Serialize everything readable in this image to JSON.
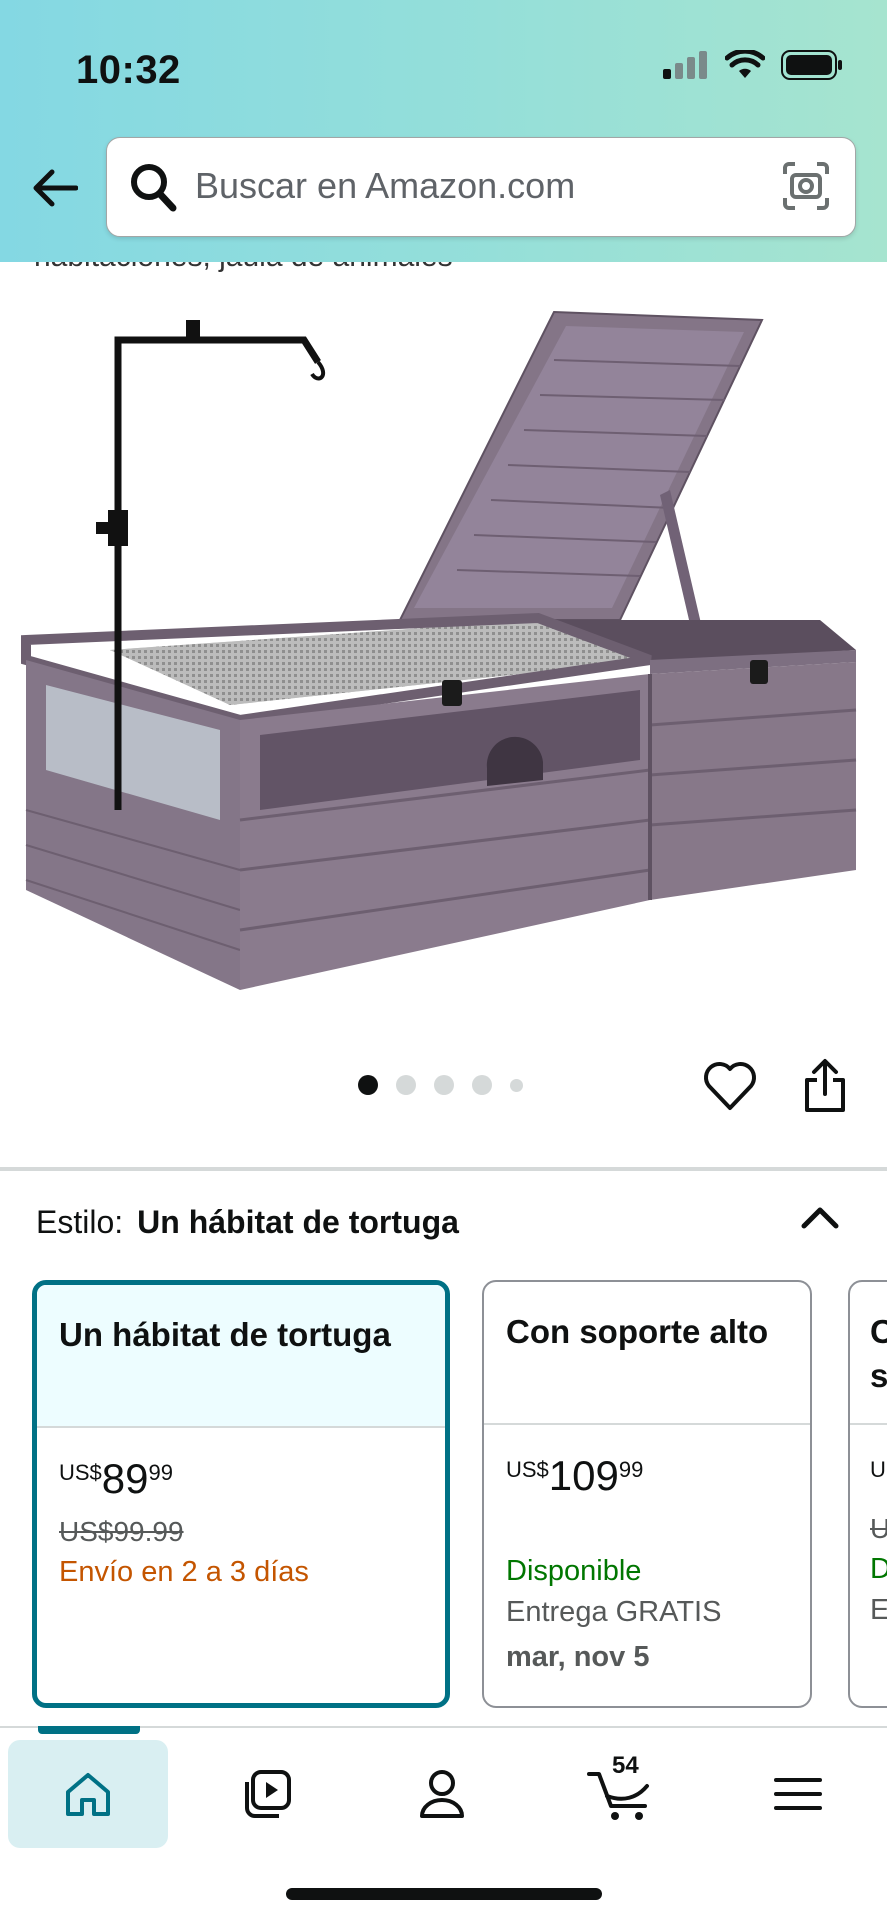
{
  "status_bar": {
    "time": "10:32"
  },
  "search": {
    "placeholder": "Buscar en Amazon.com"
  },
  "product": {
    "title_peek": "habitaciones, jaula de animales"
  },
  "carousel": {
    "total_dots": 5,
    "active_index": 0
  },
  "style_selector": {
    "label": "Estilo:",
    "selected_value": "Un hábitat de tortuga"
  },
  "style_options": [
    {
      "name": "Un hábitat de tortuga",
      "currency": "US$",
      "price_whole": "89",
      "price_fraction": "99",
      "list_price": "US$99.99",
      "shipping": "Envío en 2 a 3 días"
    },
    {
      "name": "Con soporte alto",
      "currency": "US$",
      "price_whole": "109",
      "price_fraction": "99",
      "availability": "Disponible",
      "delivery": "Entrega GRATIS",
      "delivery_date": "mar, nov 5"
    },
    {
      "name": "C s",
      "currency": "U",
      "list_price": "U",
      "availability": "D",
      "delivery": "E"
    }
  ],
  "bottom_nav": {
    "cart_count": "54"
  },
  "colors": {
    "accent": "#007185",
    "orange": "#c45500",
    "green": "#007600",
    "header_start": "#84d8e3",
    "header_end": "#a6e4cf"
  }
}
